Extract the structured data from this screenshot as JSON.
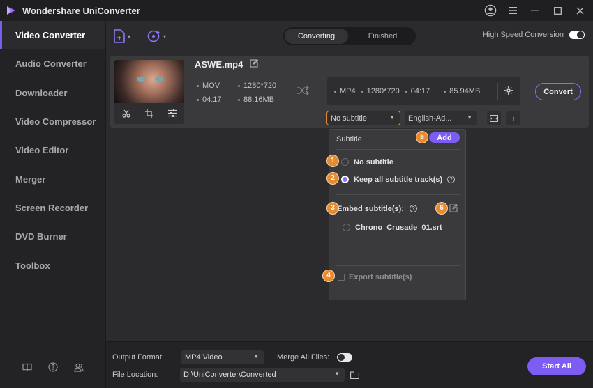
{
  "app": {
    "title": "Wondershare UniConverter"
  },
  "sidebar": {
    "items": [
      {
        "label": "Video Converter",
        "active": true
      },
      {
        "label": "Audio Converter"
      },
      {
        "label": "Downloader"
      },
      {
        "label": "Video Compressor"
      },
      {
        "label": "Video Editor"
      },
      {
        "label": "Merger"
      },
      {
        "label": "Screen Recorder"
      },
      {
        "label": "DVD Burner"
      },
      {
        "label": "Toolbox"
      }
    ],
    "bottom_icons": [
      "book-icon",
      "help-icon",
      "users-icon"
    ]
  },
  "toolbar": {
    "tabs": {
      "converting": "Converting",
      "finished": "Finished"
    },
    "high_speed_label": "High Speed Conversion"
  },
  "file": {
    "name": "ASWE.mp4",
    "source": {
      "format": "MOV",
      "resolution": "1280*720",
      "duration": "04:17",
      "size": "88.16MB"
    },
    "output": {
      "format": "MP4",
      "resolution": "1280*720",
      "duration": "04:17",
      "size": "85.94MB"
    },
    "convert_label": "Convert",
    "subtitle_value": "No subtitle",
    "audio_value": "English-Ad...",
    "info_label": "i"
  },
  "subtitle_panel": {
    "header": "Subtitle",
    "add_label": "Add",
    "no_subtitle": "No subtitle",
    "keep_all": "Keep all subtitle track(s)",
    "embed_label": "Embed subtitle(s):",
    "embed_file": "Chrono_Crusade_01.srt",
    "export_label": "Export subtitle(s)",
    "help_mark": "?",
    "badges": [
      "1",
      "2",
      "3",
      "4",
      "5",
      "6"
    ]
  },
  "bottom": {
    "output_format_label": "Output Format:",
    "output_format_value": "MP4 Video",
    "merge_label": "Merge All Files:",
    "file_location_label": "File Location:",
    "file_location_value": "D:\\UniConverter\\Converted",
    "start_all_label": "Start All"
  },
  "colors": {
    "accent": "#7c5cf2",
    "highlight": "#e88a2e",
    "bg": "#2b2b2d",
    "sidebar": "#232325"
  }
}
